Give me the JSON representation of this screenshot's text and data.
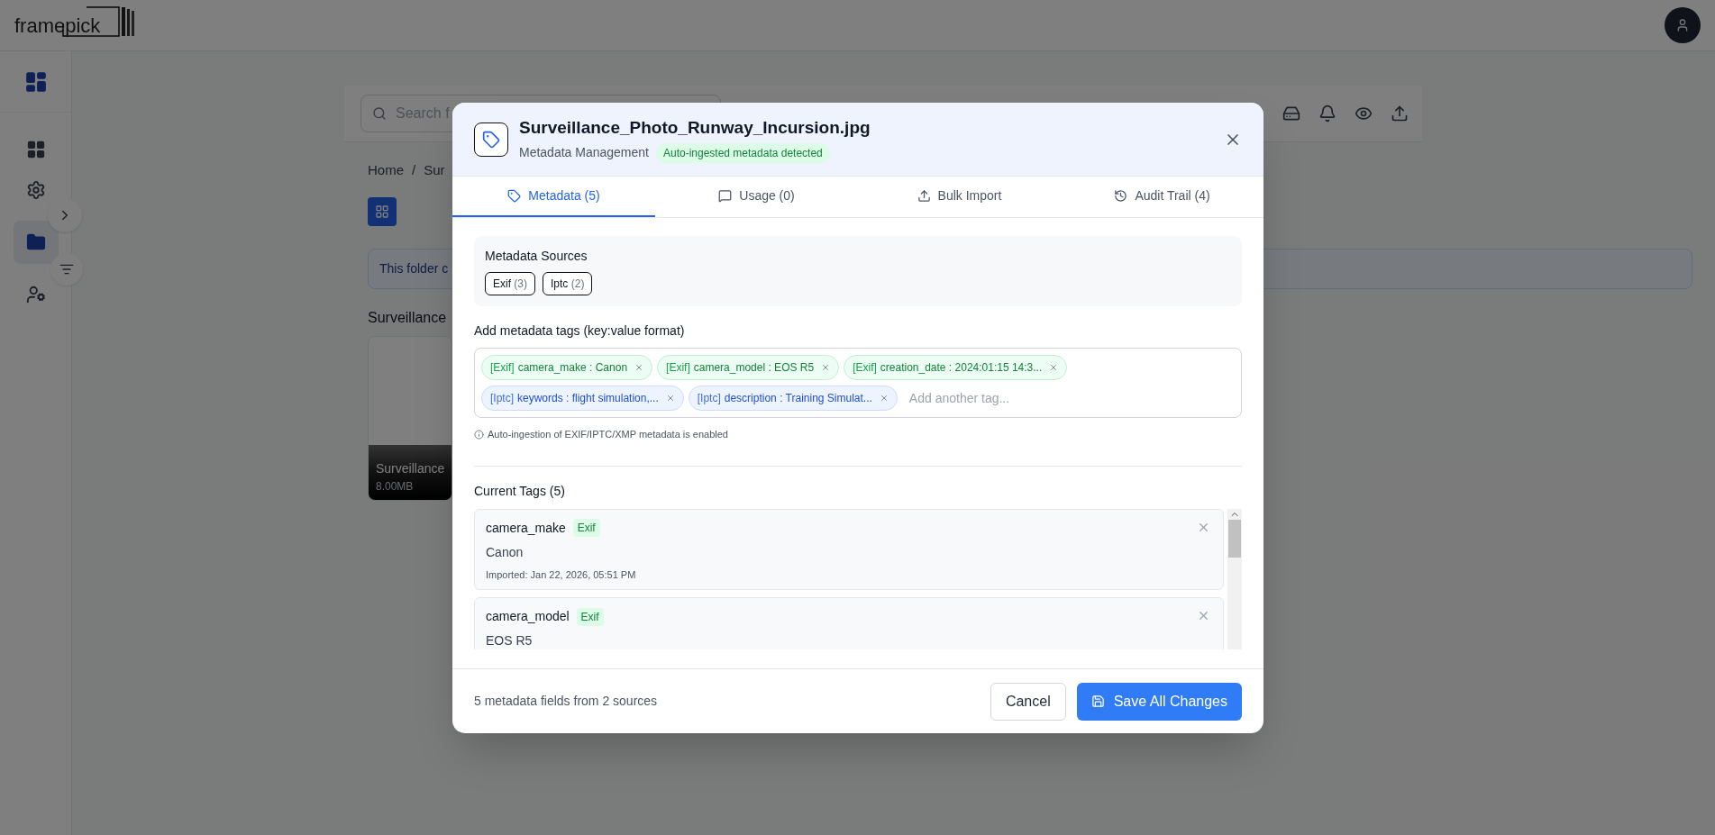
{
  "app": {
    "logo": "framepick"
  },
  "search": {
    "placeholder": "Search f"
  },
  "breadcrumb": [
    "Home",
    "/",
    "Sur"
  ],
  "banner": {
    "text": "This folder c"
  },
  "file_card": {
    "title": "Surveillance",
    "caption": "Surveillance",
    "size": "8.00MB"
  },
  "dialog": {
    "title": "Surveillance_Photo_Runway_Incursion.jpg",
    "subtitle": "Metadata Management",
    "badge": "Auto-ingested metadata detected",
    "tabs": [
      {
        "label": "Metadata (5)",
        "selected": true
      },
      {
        "label": "Usage (0)",
        "selected": false
      },
      {
        "label": "Bulk Import",
        "selected": false
      },
      {
        "label": "Audit Trail (4)",
        "selected": false
      }
    ],
    "sources": {
      "title": "Metadata Sources",
      "items": [
        {
          "name": "Exif",
          "count": "(3)"
        },
        {
          "name": "Iptc",
          "count": "(2)"
        }
      ]
    },
    "tag_input": {
      "label": "Add metadata tags (key:value format)",
      "placeholder": "Add another tag...",
      "chips": [
        {
          "kind": "exif",
          "source": "[Exif]",
          "text": "camera_make : Canon"
        },
        {
          "kind": "exif",
          "source": "[Exif]",
          "text": "camera_model : EOS R5"
        },
        {
          "kind": "exif",
          "source": "[Exif]",
          "text": "creation_date : 2024:01:15 14:3..."
        },
        {
          "kind": "iptc",
          "source": "[Iptc]",
          "text": "keywords : flight simulation,..."
        },
        {
          "kind": "iptc",
          "source": "[Iptc]",
          "text": "description : Training Simulat..."
        }
      ],
      "hint": "Auto-ingestion of EXIF/IPTC/XMP metadata is enabled"
    },
    "current_tags": {
      "title": "Current Tags (5)",
      "items": [
        {
          "key": "camera_make",
          "source": "Exif",
          "value": "Canon",
          "imported": "Imported: Jan 22, 2026, 05:51 PM"
        },
        {
          "key": "camera_model",
          "source": "Exif",
          "value": "EOS R5"
        }
      ]
    },
    "footer": {
      "summary": "5 metadata fields from 2 sources",
      "cancel": "Cancel",
      "save": "Save All Changes"
    }
  }
}
